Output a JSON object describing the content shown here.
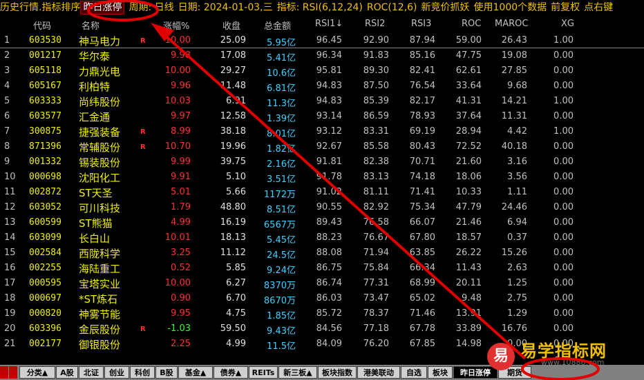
{
  "titlebar": {
    "part1": "历史行情.指标排序",
    "highlight": "昨日涨停",
    "part2": "周期: 日线",
    "part3": "日期: 2024-01-03,三",
    "part4": "指标: RSI(6,12,24)",
    "part5": "ROC(12,6)",
    "part6": "新竞价抓妖",
    "part7": "使用1000个数据",
    "part8": "前复权",
    "part9": "点右键"
  },
  "columns": {
    "code": "代码",
    "name": "名称",
    "chg": "涨幅%",
    "close": "收盘",
    "amt": "总金额",
    "rsi1": "RSI1↓",
    "rsi2": "RSI2",
    "rsi3": "RSI3",
    "roc": "ROC",
    "maroc": "MAROC",
    "xg": "XG"
  },
  "rows": [
    {
      "idx": "1",
      "code": "603530",
      "name": "神马电力",
      "flag": "R",
      "chg": "10.00",
      "close": "25.09",
      "amt": "5.95亿",
      "rsi1": "96.45",
      "rsi2": "92.90",
      "rsi3": "87.94",
      "roc": "59.00",
      "maroc": "26.43",
      "xg": "1.00",
      "dir": "up"
    },
    {
      "idx": "2",
      "code": "001217",
      "name": "华尔泰",
      "flag": "",
      "chg": "9.98",
      "close": "17.08",
      "amt": "5.41亿",
      "rsi1": "96.34",
      "rsi2": "91.83",
      "rsi3": "85.16",
      "roc": "47.75",
      "maroc": "19.08",
      "xg": "0.00",
      "dir": "up"
    },
    {
      "idx": "3",
      "code": "605118",
      "name": "力鼎光电",
      "flag": "",
      "chg": "10.00",
      "close": "29.27",
      "amt": "10.6亿",
      "rsi1": "95.81",
      "rsi2": "89.30",
      "rsi3": "82.41",
      "roc": "62.61",
      "maroc": "27.85",
      "xg": "0.00",
      "dir": "up"
    },
    {
      "idx": "4",
      "code": "605167",
      "name": "利柏特",
      "flag": "",
      "chg": "9.96",
      "close": "11.48",
      "amt": "6.81亿",
      "rsi1": "94.83",
      "rsi2": "87.50",
      "rsi3": "76.54",
      "roc": "33.64",
      "maroc": "9.68",
      "xg": "0.00",
      "dir": "up"
    },
    {
      "idx": "5",
      "code": "603333",
      "name": "尚纬股份",
      "flag": "",
      "chg": "10.03",
      "close": "6.91",
      "amt": "11.3亿",
      "rsi1": "94.83",
      "rsi2": "85.39",
      "rsi3": "82.17",
      "roc": "41.31",
      "maroc": "14.21",
      "xg": "1.00",
      "dir": "up"
    },
    {
      "idx": "6",
      "code": "603577",
      "name": "汇金通",
      "flag": "",
      "chg": "9.97",
      "close": "12.58",
      "amt": "1.39亿",
      "rsi1": "93.14",
      "rsi2": "86.59",
      "rsi3": "78.93",
      "roc": "37.64",
      "maroc": "11.31",
      "xg": "0.00",
      "dir": "up"
    },
    {
      "idx": "7",
      "code": "300875",
      "name": "捷强装备",
      "flag": "R",
      "chg": "8.99",
      "close": "38.18",
      "amt": "8.01亿",
      "rsi1": "93.12",
      "rsi2": "83.31",
      "rsi3": "69.19",
      "roc": "28.94",
      "maroc": "4.42",
      "xg": "1.00",
      "dir": "up"
    },
    {
      "idx": "8",
      "code": "871396",
      "name": "常辅股份",
      "flag": "R",
      "chg": "10.70",
      "close": "19.96",
      "amt": "1.82亿",
      "rsi1": "92.67",
      "rsi2": "85.58",
      "rsi3": "80.43",
      "roc": "72.52",
      "maroc": "40.18",
      "xg": "0.00",
      "dir": "up"
    },
    {
      "idx": "9",
      "code": "001332",
      "name": "锡装股份",
      "flag": "",
      "chg": "9.99",
      "close": "39.75",
      "amt": "2.16亿",
      "rsi1": "91.81",
      "rsi2": "82.38",
      "rsi3": "70.71",
      "roc": "21.60",
      "maroc": "3.16",
      "xg": "0.00",
      "dir": "up"
    },
    {
      "idx": "10",
      "code": "000698",
      "name": "沈阳化工",
      "flag": "",
      "chg": "9.91",
      "close": "5.10",
      "amt": "3.51亿",
      "rsi1": "91.78",
      "rsi2": "83.13",
      "rsi3": "74.18",
      "roc": "18.06",
      "maroc": "3.56",
      "xg": "0.00",
      "dir": "up"
    },
    {
      "idx": "11",
      "code": "002872",
      "name": "ST天圣",
      "flag": "",
      "chg": "5.01",
      "close": "5.66",
      "amt": "1172万",
      "rsi1": "91.02",
      "rsi2": "81.11",
      "rsi3": "71.41",
      "roc": "10.33",
      "maroc": "1.11",
      "xg": "0.00",
      "dir": "up"
    },
    {
      "idx": "12",
      "code": "603052",
      "name": "可川科技",
      "flag": "",
      "chg": "1.79",
      "close": "48.80",
      "amt": "8.51亿",
      "rsi1": "90.55",
      "rsi2": "82.92",
      "rsi3": "75.34",
      "roc": "47.79",
      "maroc": "24.46",
      "xg": "0.00",
      "dir": "up"
    },
    {
      "idx": "13",
      "code": "600599",
      "name": "ST熊猫",
      "flag": "",
      "chg": "4.99",
      "close": "16.19",
      "amt": "6567万",
      "rsi1": "89.43",
      "rsi2": "76.58",
      "rsi3": "66.07",
      "roc": "21.46",
      "maroc": "6.94",
      "xg": "0.00",
      "dir": "up"
    },
    {
      "idx": "14",
      "code": "603099",
      "name": "长白山",
      "flag": "",
      "chg": "10.01",
      "close": "18.13",
      "amt": "5.45亿",
      "rsi1": "88.23",
      "rsi2": "76.67",
      "rsi3": "67.80",
      "roc": "18.57",
      "maroc": "0.37",
      "xg": "0.00",
      "dir": "up"
    },
    {
      "idx": "15",
      "code": "002584",
      "name": "西陇科学",
      "flag": "",
      "chg": "3.25",
      "close": "11.12",
      "amt": "24.5亿",
      "rsi1": "88.08",
      "rsi2": "71.94",
      "rsi3": "63.85",
      "roc": "26.22",
      "maroc": "15.26",
      "xg": "0.00",
      "dir": "up"
    },
    {
      "idx": "16",
      "code": "002255",
      "name": "海陆重工",
      "flag": "",
      "chg": "0.52",
      "close": "5.85",
      "amt": "9.24亿",
      "rsi1": "86.75",
      "rsi2": "75.84",
      "rsi3": "66.34",
      "roc": "11.43",
      "maroc": "2.63",
      "xg": "0.00",
      "dir": "up"
    },
    {
      "idx": "17",
      "code": "000595",
      "name": "宝塔实业",
      "flag": "",
      "chg": "10.00",
      "close": "6.27",
      "amt": "8370万",
      "rsi1": "86.74",
      "rsi2": "77.31",
      "rsi3": "68.99",
      "roc": "20.11",
      "maroc": "1.25",
      "xg": "0.00",
      "dir": "up"
    },
    {
      "idx": "18",
      "code": "000697",
      "name": "*ST炼石",
      "flag": "",
      "chg": "0.90",
      "close": "6.70",
      "amt": "8670万",
      "rsi1": "86.03",
      "rsi2": "73.47",
      "rsi3": "65.02",
      "roc": "9.48",
      "maroc": "2.75",
      "xg": "0.00",
      "dir": "up"
    },
    {
      "idx": "19",
      "code": "000820",
      "name": "神雾节能",
      "flag": "",
      "chg": "9.95",
      "close": "4.75",
      "amt": "1.85亿",
      "rsi1": "85.72",
      "rsi2": "78.37",
      "rsi3": "71.46",
      "roc": "13.91",
      "maroc": "1.29",
      "xg": "0.00",
      "dir": "up"
    },
    {
      "idx": "20",
      "code": "603396",
      "name": "金辰股份",
      "flag": "R",
      "chg": "-1.03",
      "close": "59.50",
      "amt": "9.43亿",
      "rsi1": "84.56",
      "rsi2": "77.18",
      "rsi3": "67.78",
      "roc": "33.89",
      "maroc": "16.76",
      "xg": "0.00",
      "dir": "dn"
    },
    {
      "idx": "21",
      "code": "002177",
      "name": "御银股份",
      "flag": "",
      "chg": "2.25",
      "close": "4.99",
      "amt": "11.5亿",
      "rsi1": "84.09",
      "rsi2": "76.20",
      "rsi3": "67.85",
      "roc": "14.98",
      "maroc": "0.00",
      "xg": "0.00",
      "dir": "up"
    }
  ],
  "tabs": [
    "分类▲",
    "A股",
    "北证",
    "创业",
    "科创",
    "B股",
    "基金▲",
    "债券▲",
    "REITs",
    "新三板▲",
    "板块指数",
    "港美联动",
    "自选",
    "板块",
    "昨日涨停",
    "期货"
  ],
  "active_tab": "昨日涨停",
  "watermark": {
    "text": "易学指标网",
    "logo": "易",
    "url": "www.10886.com"
  },
  "colors": {
    "up": "#ff3030",
    "down": "#30ff30",
    "code": "#f0f000",
    "amount": "#40d0ff",
    "annotation": "#e00000"
  }
}
